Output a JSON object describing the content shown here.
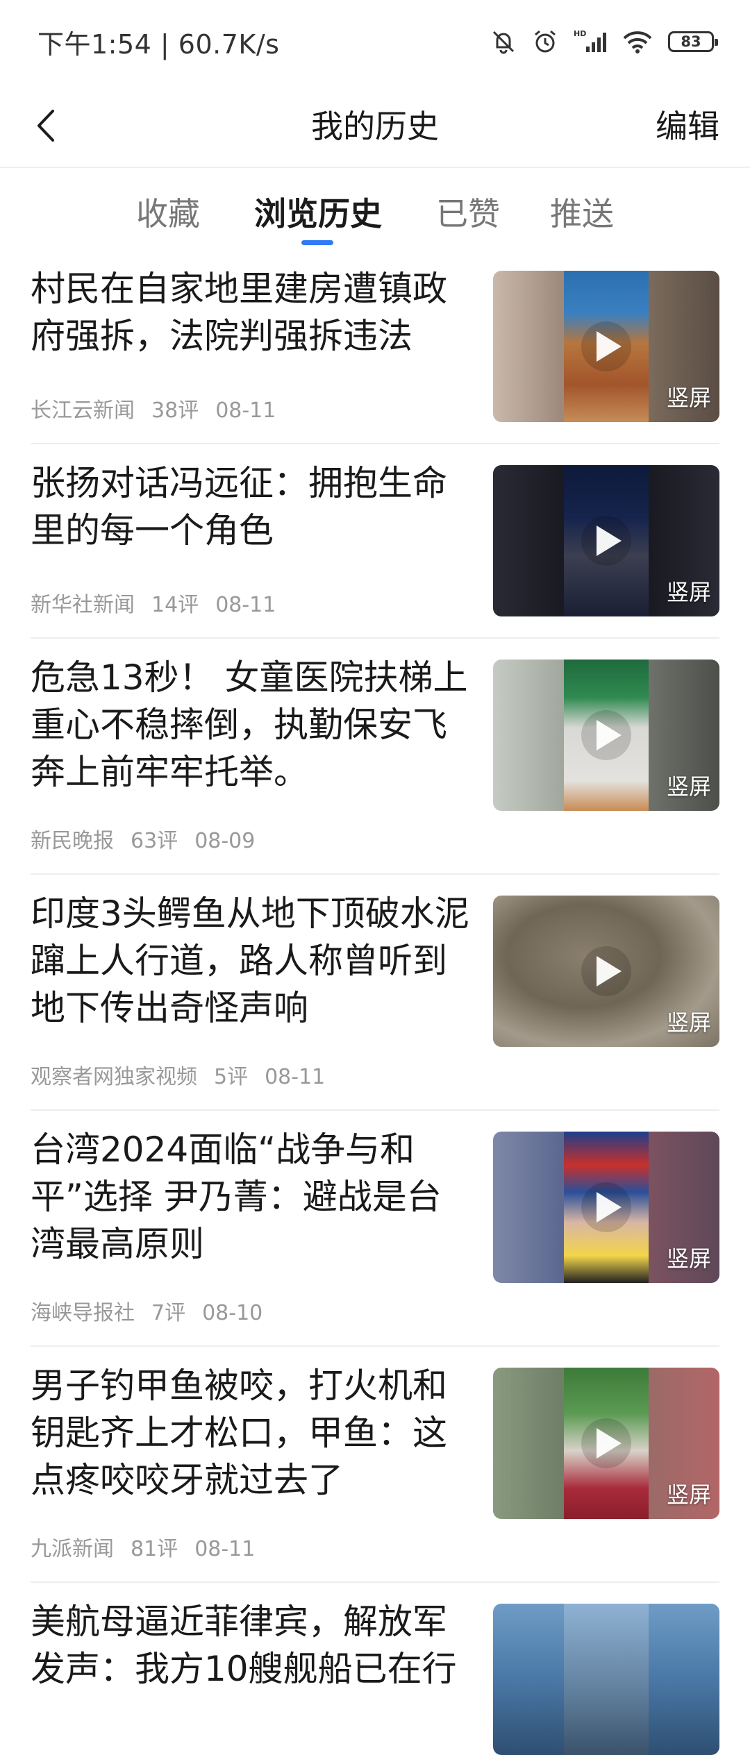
{
  "status": {
    "time": "下午1:54 | 60.7K/s",
    "battery": "83"
  },
  "header": {
    "title": "我的历史",
    "edit": "编辑"
  },
  "tabs": [
    {
      "label": "收藏"
    },
    {
      "label": "浏览历史"
    },
    {
      "label": "已赞"
    },
    {
      "label": "推送"
    }
  ],
  "active_tab": "浏览历史",
  "items": [
    {
      "title": "村民在自家地里建房遭镇政府强拆，法院判强拆违法",
      "source": "长江云新闻",
      "comments": "38评",
      "date": "08-11",
      "badge": "竖屏"
    },
    {
      "title": "张扬对话冯远征：拥抱生命里的每一个角色",
      "source": "新华社新闻",
      "comments": "14评",
      "date": "08-11",
      "badge": "竖屏"
    },
    {
      "title": "危急13秒！ 女童医院扶梯上重心不稳摔倒，执勤保安飞奔上前牢牢托举。",
      "source": "新民晚报",
      "comments": "63评",
      "date": "08-09",
      "badge": "竖屏"
    },
    {
      "title": "印度3头鳄鱼从地下顶破水泥蹿上人行道，路人称曾听到地下传出奇怪声响",
      "source": "观察者网独家视频",
      "comments": "5评",
      "date": "08-11",
      "badge": "竖屏"
    },
    {
      "title": "台湾2024面临“战争与和平”选择 尹乃菁：避战是台湾最高原则",
      "source": "海峡导报社",
      "comments": "7评",
      "date": "08-10",
      "badge": "竖屏"
    },
    {
      "title": "男子钓甲鱼被咬，打火机和钥匙齐上才松口，甲鱼：这点疼咬咬牙就过去了",
      "source": "九派新闻",
      "comments": "81评",
      "date": "08-11",
      "badge": "竖屏"
    },
    {
      "title": "美航母逼近菲律宾，解放军发声：我方10艘舰船已在行",
      "source": "",
      "comments": "",
      "date": "",
      "badge": ""
    }
  ]
}
